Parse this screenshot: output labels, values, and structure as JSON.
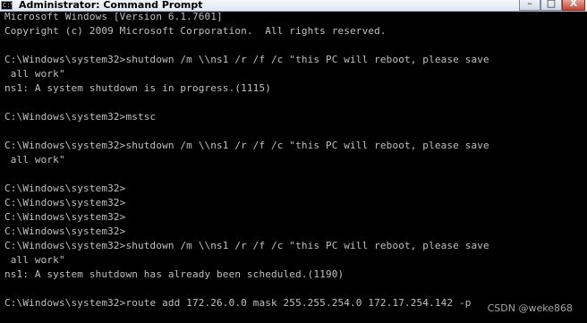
{
  "window": {
    "title": "Administrator: Command Prompt",
    "icon_text": "C:\\",
    "controls": {
      "minimize": "–",
      "maximize": "□",
      "close": "X"
    }
  },
  "console": {
    "lines": [
      "Microsoft Windows [Version 6.1.7601]",
      "Copyright (c) 2009 Microsoft Corporation.  All rights reserved.",
      "",
      "C:\\Windows\\system32>shutdown /m \\\\ns1 /r /f /c \"this PC will reboot, please save",
      " all work\"",
      "ns1: A system shutdown is in progress.(1115)",
      "",
      "C:\\Windows\\system32>mstsc",
      "",
      "C:\\Windows\\system32>shutdown /m \\\\ns1 /r /f /c \"this PC will reboot, please save",
      " all work\"",
      "",
      "C:\\Windows\\system32>",
      "C:\\Windows\\system32>",
      "C:\\Windows\\system32>",
      "C:\\Windows\\system32>",
      "C:\\Windows\\system32>shutdown /m \\\\ns1 /r /f /c \"this PC will reboot, please save",
      " all work\"",
      "ns1: A system shutdown has already been scheduled.(1190)",
      "",
      "C:\\Windows\\system32>route add 172.26.0.0 mask 255.255.254.0 172.17.254.142 -p"
    ]
  },
  "watermark": "CSDN @weke868",
  "colors": {
    "console_background": "#000000",
    "console_text": "#c0c0c0",
    "titlebar": "#dfe7f1",
    "close_button": "#c8432f"
  }
}
